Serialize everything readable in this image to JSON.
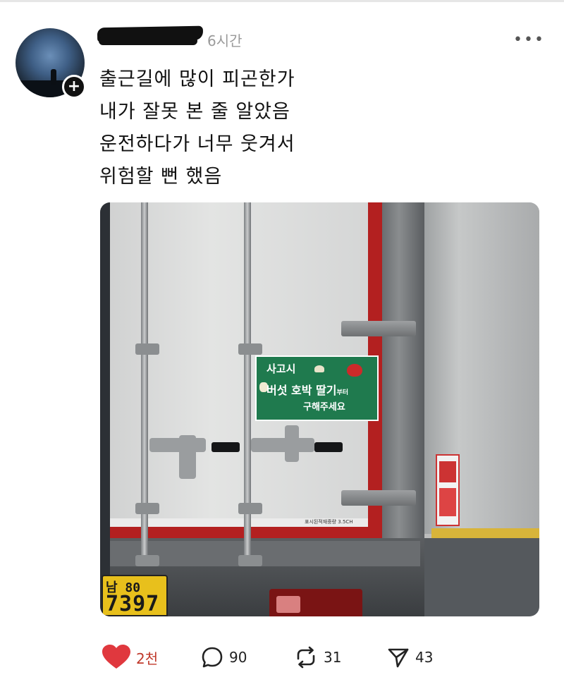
{
  "post": {
    "author_avatar_icon": "avatar-image",
    "follow_badge_icon": "plus-icon",
    "follow_badge_symbol": "+",
    "timestamp": "6시간",
    "more_icon": "more-horizontal-icon",
    "more_symbol": "•••",
    "caption_lines": [
      "출근길에 많이 피곤한가",
      "내가 잘못 본 줄 알았음",
      "운전하다가 너무 웃겨서",
      "위험할 뻔 했음"
    ],
    "photo": {
      "sign_line1": "사고시",
      "sign_line2": "버섯 호박 딸기",
      "sign_line2_suffix": "부터",
      "sign_line3": "구해주세요",
      "plate_top": "남 80",
      "plate_bottom": "7397",
      "sticker_text": "표시된적재중량 3.5CH"
    },
    "actions": {
      "like": {
        "icon": "heart-icon",
        "count": "2천",
        "color": "#e0383e"
      },
      "comment": {
        "icon": "comment-icon",
        "count": "90"
      },
      "repost": {
        "icon": "repost-icon",
        "count": "31"
      },
      "share": {
        "icon": "send-icon",
        "count": "43"
      }
    }
  }
}
